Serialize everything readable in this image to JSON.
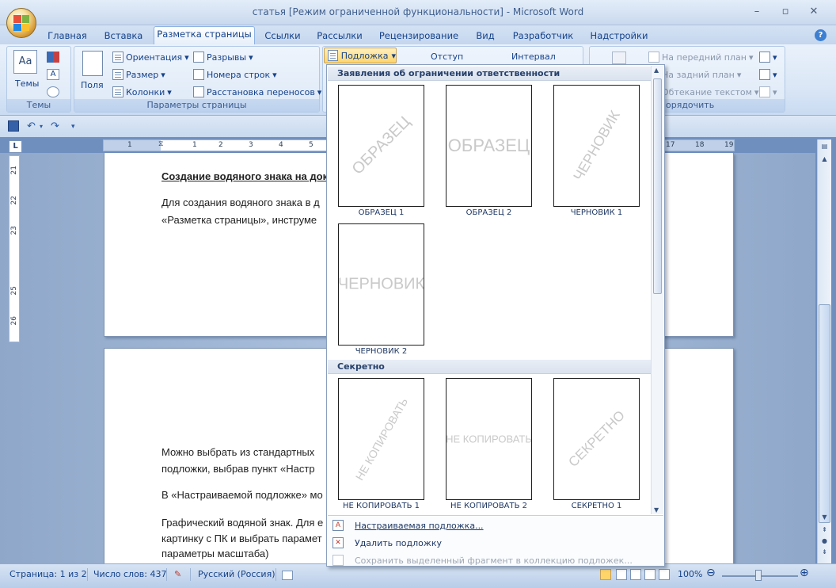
{
  "window": {
    "title": "статья [Режим ограниченной функциональности] - Microsoft Word"
  },
  "tabs": [
    {
      "label": "Главная"
    },
    {
      "label": "Вставка"
    },
    {
      "label": "Разметка страницы"
    },
    {
      "label": "Ссылки"
    },
    {
      "label": "Рассылки"
    },
    {
      "label": "Рецензирование"
    },
    {
      "label": "Вид"
    },
    {
      "label": "Разработчик"
    },
    {
      "label": "Надстройки"
    }
  ],
  "ribbon": {
    "themes": {
      "button": "Темы",
      "group": "Темы"
    },
    "page_setup": {
      "fields": "Поля",
      "orientation": "Ориентация",
      "size": "Размер",
      "columns": "Колонки",
      "breaks": "Разрывы",
      "line_numbers": "Номера строк",
      "hyphenation": "Расстановка переносов",
      "group": "Параметры страницы"
    },
    "watermark": "Подложка",
    "indent": "Отступ",
    "spacing": "Интервал",
    "arrange": {
      "bring_front": "На передний план",
      "send_back": "На задний план",
      "text_wrap": "Обтекание текстом",
      "group": "порядочить"
    }
  },
  "ruler": {
    "h_numbers": [
      "1",
      "1",
      "2",
      "3",
      "4",
      "5",
      "17",
      "18",
      "19"
    ],
    "v_numbers": [
      "21",
      "22",
      "23",
      "25",
      "26"
    ]
  },
  "document": {
    "heading": "Создание водяного знака на док",
    "p1_line1": "Для создания водяного знака в д",
    "p1_line2": "«Разметка страницы», инструме",
    "p2_line1": "Можно выбрать из стандартных",
    "p2_line2": "подложки, выбрав пункт «Настр",
    "p3_line1": "В «Настраиваемой подложке» мо",
    "p4_line1": "Графический водяной знак. Для е",
    "p4_line2": "картинку с ПК и выбрать парамет",
    "p4_line3": "параметры масштаба)"
  },
  "gallery": {
    "section1": "Заявления об ограничении ответственности",
    "section2": "Секретно",
    "items": [
      {
        "label": "ОБРАЗЕЦ 1",
        "mark": "ОБРАЗЕЦ"
      },
      {
        "label": "ОБРАЗЕЦ 2",
        "mark": "ОБРАЗЕЦ"
      },
      {
        "label": "ЧЕРНОВИК 1",
        "mark": "ЧЕРНОВИК"
      },
      {
        "label": "ЧЕРНОВИК 2",
        "mark": "ЧЕРНОВИК"
      },
      {
        "label": "НЕ КОПИРОВАТЬ 1",
        "mark": "НЕ КОПИРОВАТЬ"
      },
      {
        "label": "НЕ КОПИРОВАТЬ 2",
        "mark": "НЕ КОПИРОВАТЬ"
      },
      {
        "label": "СЕКРЕТНО 1",
        "mark": "СЕКРЕТНО"
      }
    ],
    "menu": {
      "custom": "Настраиваемая подложка...",
      "remove": "Удалить подложку",
      "save": "Сохранить выделенный фрагмент в коллекцию подложек..."
    }
  },
  "status": {
    "page": "Страница: 1 из 2",
    "words": "Число слов: 437",
    "language": "Русский (Россия)",
    "zoom": "100%"
  },
  "colors": {
    "accent": "#15428b",
    "ribbon_bg": "#dbe7f6",
    "highlight": "#ffd56a"
  }
}
